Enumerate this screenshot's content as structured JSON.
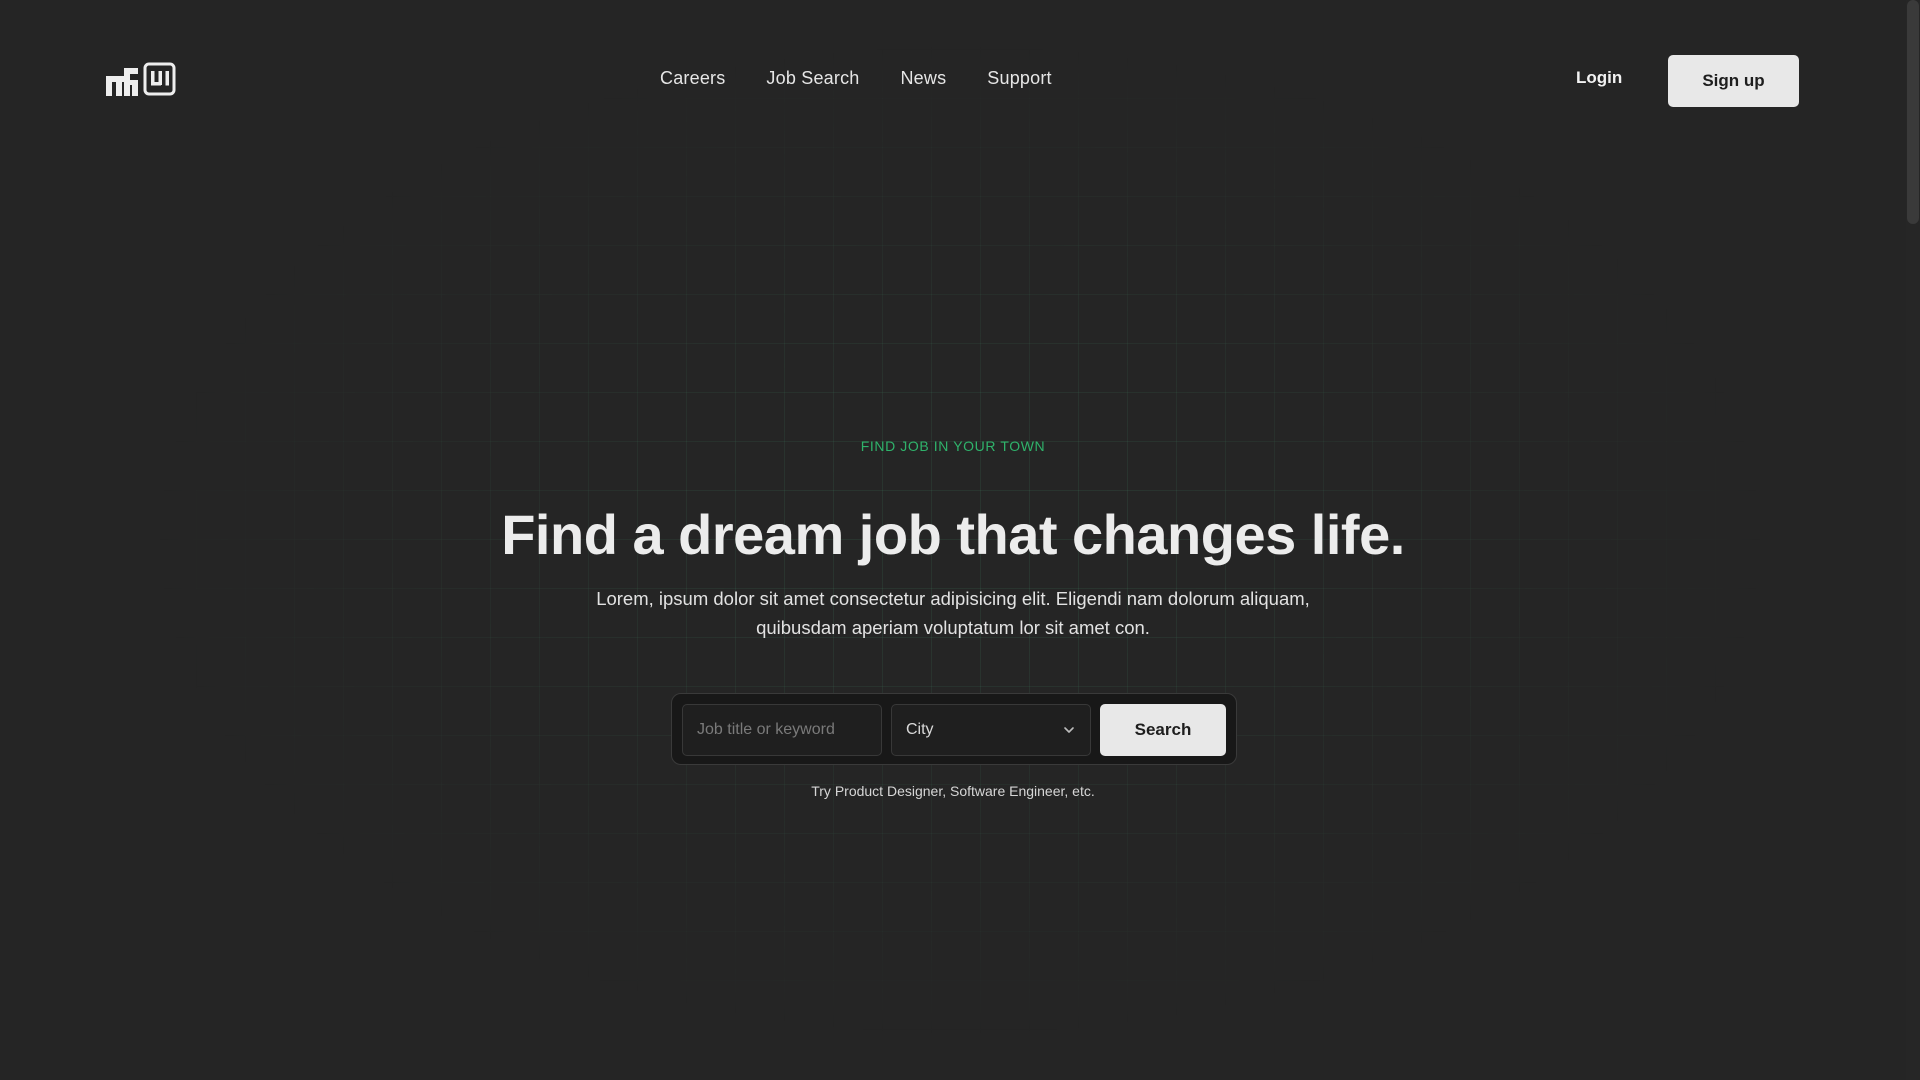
{
  "header": {
    "logo_alt": "mf UI",
    "nav": [
      {
        "label": "Careers"
      },
      {
        "label": "Job Search"
      },
      {
        "label": "News"
      },
      {
        "label": "Support"
      }
    ],
    "login_label": "Login",
    "signup_label": "Sign up"
  },
  "hero": {
    "eyebrow": "FIND JOB IN YOUR TOWN",
    "headline": "Find a dream job that changes life.",
    "subtext": "Lorem, ipsum dolor sit amet consectetur adipisicing elit. Eligendi nam dolorum aliquam, quibusdam aperiam voluptatum lor sit amet con."
  },
  "search": {
    "keyword_placeholder": "Job title or keyword",
    "keyword_value": "",
    "city_value": "City",
    "button_label": "Search",
    "hint": "Try Product Designer, Software Engineer, etc."
  },
  "colors": {
    "background": "#252525",
    "accent": "#2fb36b",
    "button_bg": "#e8e8e8",
    "button_text": "#1e1e1e"
  },
  "icons": {
    "logo": "mf-ui-logo-icon",
    "dropdown": "chevron-down-icon"
  }
}
